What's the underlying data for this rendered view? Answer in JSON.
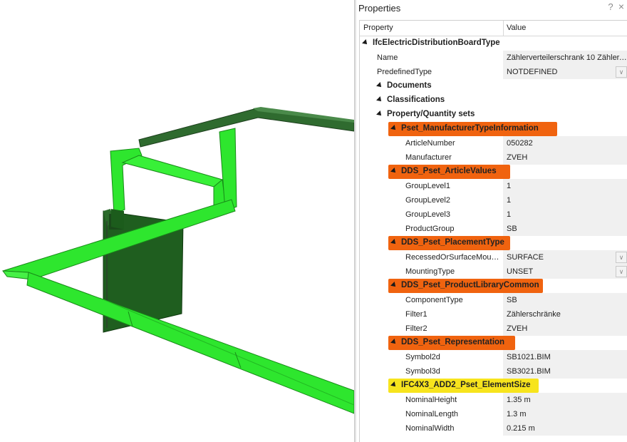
{
  "panel": {
    "title": "Properties",
    "help_glyph": "?",
    "close_glyph": "×",
    "header_property": "Property",
    "header_value": "Value"
  },
  "viewport": {
    "accent_green": "#2ee62e",
    "dark_green": "#2f6b2f",
    "cabinet_green": "#1c5c1c"
  },
  "rows": [
    {
      "kind": "group",
      "level": 0,
      "label": "IfcElectricDistributionBoardType"
    },
    {
      "kind": "prop",
      "level": 1,
      "label": "Name",
      "value": "Zählerverteilerschrank 10 Zähler, ..."
    },
    {
      "kind": "prop",
      "level": 1,
      "label": "PredefinedType",
      "value": "NOTDEFINED",
      "dropdown": true
    },
    {
      "kind": "group",
      "level": 1,
      "label": "Documents"
    },
    {
      "kind": "group",
      "level": 1,
      "label": "Classifications"
    },
    {
      "kind": "group",
      "level": 1,
      "label": "Property/Quantity sets"
    },
    {
      "kind": "group",
      "level": 2,
      "label": "Pset_ManufacturerTypeInformation",
      "highlight": "orange"
    },
    {
      "kind": "prop",
      "level": 3,
      "label": "ArticleNumber",
      "value": "050282"
    },
    {
      "kind": "prop",
      "level": 3,
      "label": "Manufacturer",
      "value": "ZVEH"
    },
    {
      "kind": "group",
      "level": 2,
      "label": "DDS_Pset_ArticleValues",
      "highlight": "orange"
    },
    {
      "kind": "prop",
      "level": 3,
      "label": "GroupLevel1",
      "value": "1"
    },
    {
      "kind": "prop",
      "level": 3,
      "label": "GroupLevel2",
      "value": "1"
    },
    {
      "kind": "prop",
      "level": 3,
      "label": "GroupLevel3",
      "value": "1"
    },
    {
      "kind": "prop",
      "level": 3,
      "label": "ProductGroup",
      "value": "SB"
    },
    {
      "kind": "group",
      "level": 2,
      "label": "DDS_Pset_PlacementType",
      "highlight": "orange"
    },
    {
      "kind": "prop",
      "level": 3,
      "label": "RecessedOrSurfaceMount...",
      "value": "SURFACE",
      "dropdown": true
    },
    {
      "kind": "prop",
      "level": 3,
      "label": "MountingType",
      "value": "UNSET",
      "dropdown": true
    },
    {
      "kind": "group",
      "level": 2,
      "label": "DDS_Pset_ProductLibraryCommon",
      "highlight": "orange"
    },
    {
      "kind": "prop",
      "level": 3,
      "label": "ComponentType",
      "value": "SB"
    },
    {
      "kind": "prop",
      "level": 3,
      "label": "Filter1",
      "value": "Zählerschränke"
    },
    {
      "kind": "prop",
      "level": 3,
      "label": "Filter2",
      "value": "ZVEH"
    },
    {
      "kind": "group",
      "level": 2,
      "label": "DDS_Pset_Representation",
      "highlight": "orange"
    },
    {
      "kind": "prop",
      "level": 3,
      "label": "Symbol2d",
      "value": "SB1021.BIM"
    },
    {
      "kind": "prop",
      "level": 3,
      "label": "Symbol3d",
      "value": "SB3021.BIM"
    },
    {
      "kind": "group",
      "level": 2,
      "label": "IFC4X3_ADD2_Pset_ElementSize",
      "highlight": "yellow"
    },
    {
      "kind": "prop",
      "level": 3,
      "label": "NominalHeight",
      "value": "1.35 m"
    },
    {
      "kind": "prop",
      "level": 3,
      "label": "NominalLength",
      "value": "1.3 m"
    },
    {
      "kind": "prop",
      "level": 3,
      "label": "NominalWidth",
      "value": "0.215 m"
    }
  ]
}
